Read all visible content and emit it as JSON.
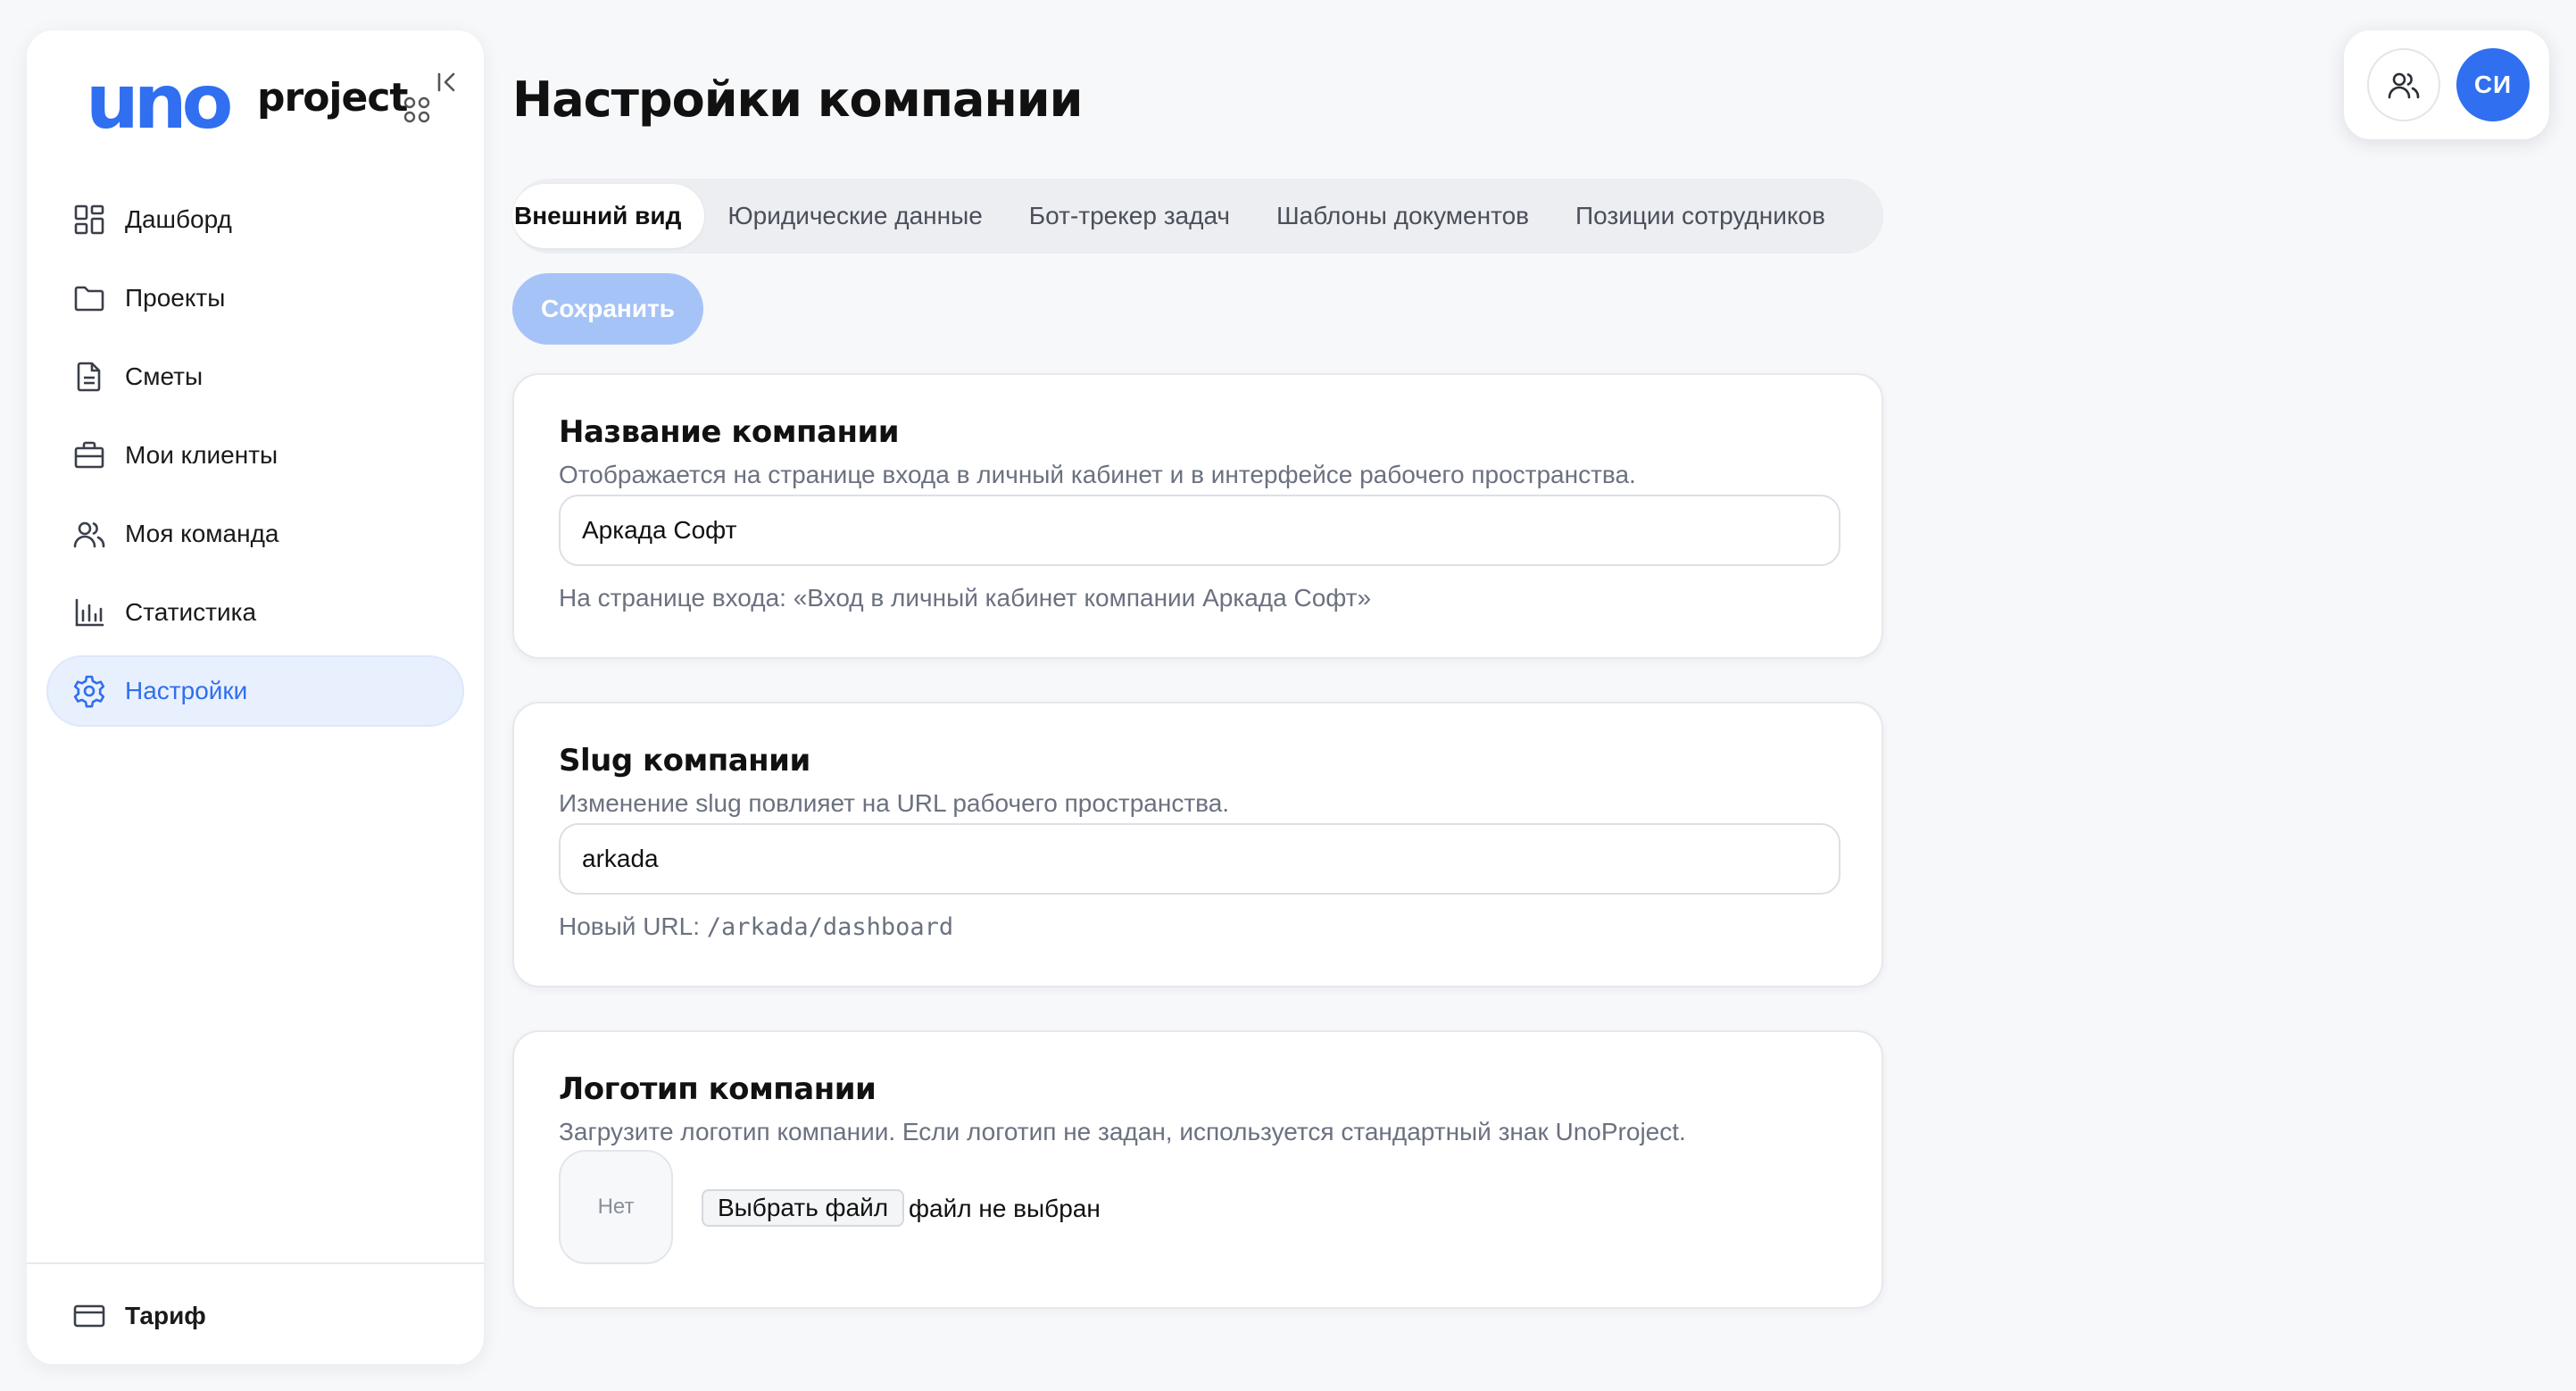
{
  "brand": {
    "name_primary": "uno",
    "name_secondary": "project"
  },
  "sidebar": {
    "items": [
      {
        "label": "Дашборд",
        "icon": "dashboard-icon"
      },
      {
        "label": "Проекты",
        "icon": "folder-icon"
      },
      {
        "label": "Сметы",
        "icon": "document-icon"
      },
      {
        "label": "Мои клиенты",
        "icon": "briefcase-icon"
      },
      {
        "label": "Моя команда",
        "icon": "users-icon"
      },
      {
        "label": "Статистика",
        "icon": "bar-chart-icon"
      },
      {
        "label": "Настройки",
        "icon": "gear-icon",
        "active": true
      }
    ],
    "footer": {
      "label": "Тариф",
      "icon": "credit-card-icon"
    }
  },
  "header": {
    "avatar_initials": "СИ"
  },
  "page": {
    "title": "Настройки компании"
  },
  "tabs": [
    {
      "label": "Внешний вид",
      "active": true
    },
    {
      "label": "Юридические данные"
    },
    {
      "label": "Бот-трекер задач"
    },
    {
      "label": "Шаблоны документов"
    },
    {
      "label": "Позиции сотрудников"
    }
  ],
  "save_label": "Сохранить",
  "sections": {
    "company_name": {
      "title": "Название компании",
      "description": "Отображается на странице входа в личный кабинет и в интерфейсе рабочего пространства.",
      "value": "Аркада Софт",
      "hint": "На странице входа: «Вход в личный кабинет компании Аркада Софт»"
    },
    "slug": {
      "title": "Slug компании",
      "description": "Изменение slug повлияет на URL рабочего пространства.",
      "value": "arkada",
      "hint_prefix": "Новый URL:",
      "hint_url": "/arkada/dashboard"
    },
    "logo": {
      "title": "Логотип компании",
      "description": "Загрузите логотип компании. Если логотип не задан, используется стандартный знак UnoProject.",
      "placeholder": "Нет",
      "file_button": "Выбрать файл",
      "file_status": "файл не выбран"
    }
  },
  "colors": {
    "accent": "#2f6ff0",
    "accent_soft": "#e9f0fd",
    "save_disabled": "#a6c3f7"
  }
}
